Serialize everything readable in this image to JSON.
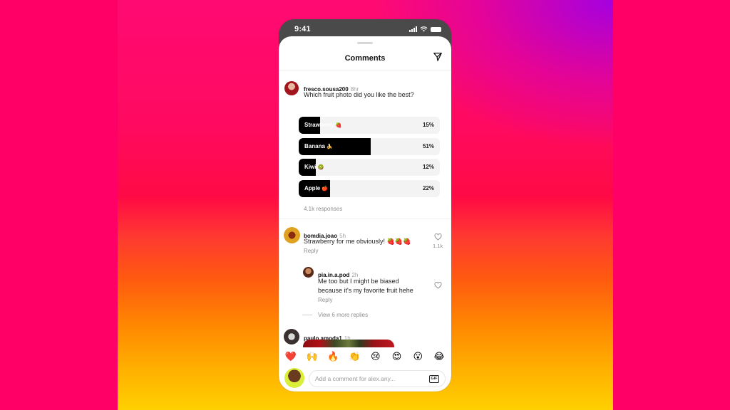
{
  "status_bar": {
    "time": "9:41"
  },
  "header": {
    "title": "Comments",
    "share_icon": "send-icon"
  },
  "post_comment": {
    "username": "fresco.sousa200",
    "time": "8hr",
    "text": "Which fruit photo did you like the best?",
    "poll": {
      "options": [
        {
          "label": "Strawberry",
          "emoji": "🍓",
          "percent": 15,
          "percent_label": "15%"
        },
        {
          "label": "Banana",
          "emoji": "🍌",
          "percent": 51,
          "percent_label": "51%"
        },
        {
          "label": "Kiwi",
          "emoji": "🥝",
          "percent": 12,
          "percent_label": "12%"
        },
        {
          "label": "Apple",
          "emoji": "🍎",
          "percent": 22,
          "percent_label": "22%"
        }
      ],
      "responses": "4.1k responses"
    }
  },
  "comments": [
    {
      "username": "bomdia.joao",
      "time": "5h",
      "text": "Strawberry for me obviously! 🍓🍓🍓",
      "reply_label": "Reply",
      "likes": "1.1k"
    }
  ],
  "reply": {
    "username": "pia.in.a.pod",
    "time": "2h",
    "text": "Me too but I might be biased because it's my favorite fruit hehe",
    "reply_label": "Reply"
  },
  "view_more": "View 6 more replies",
  "third_comment": {
    "username": "paulo.amoda1",
    "time": "1h"
  },
  "emoji_bar": [
    "❤️",
    "🙌",
    "🔥",
    "👏",
    "😢",
    "😍",
    "😮",
    "😂"
  ],
  "composer": {
    "placeholder": "Add a comment for alex.any...",
    "value": "",
    "gif_label": "GIF"
  },
  "colors": {
    "background": "#ff0066",
    "poll_fill": "#000000",
    "poll_track": "#f3f3f3"
  }
}
